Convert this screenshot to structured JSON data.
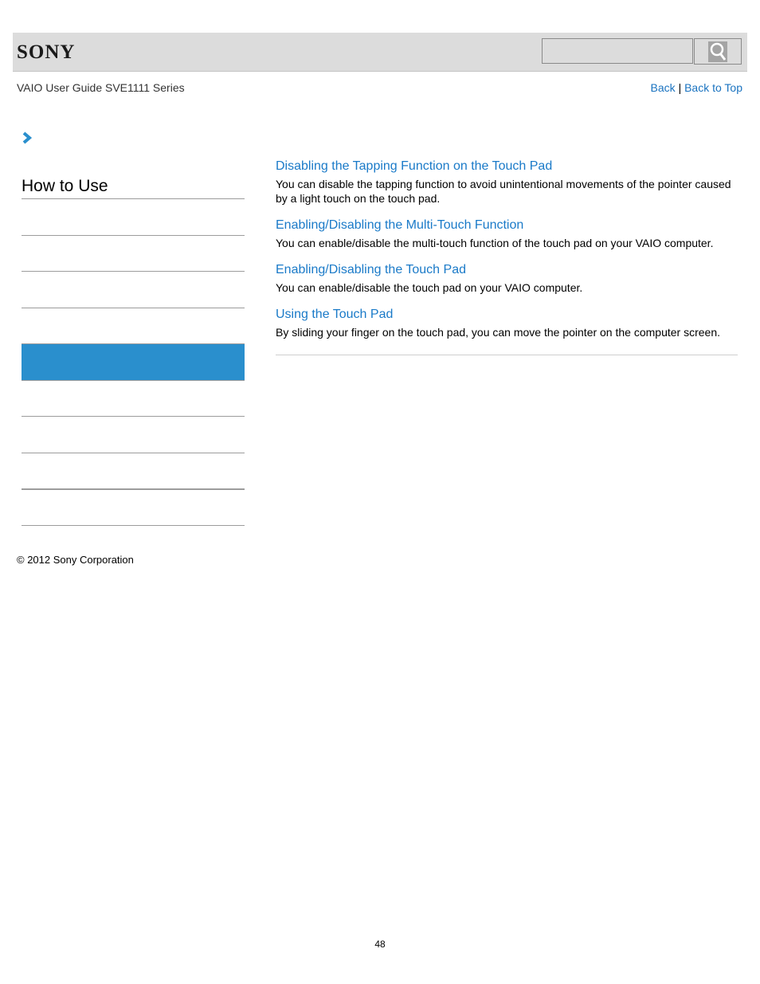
{
  "header": {
    "logo": "SONY",
    "search": {
      "placeholder": "",
      "value": "",
      "button_icon": "search-icon"
    }
  },
  "guide_title": "VAIO User Guide SVE1111 Series",
  "nav": {
    "back": "Back",
    "separator": "|",
    "back_to_top": "Back to Top"
  },
  "breadcrumb": {
    "icon": "chevron-right-icon"
  },
  "sidebar": {
    "title": "How to Use",
    "items": [
      {
        "label": "",
        "active": false
      },
      {
        "label": "",
        "active": false
      },
      {
        "label": "",
        "active": false
      },
      {
        "label": "",
        "active": false
      },
      {
        "label": "",
        "active": true
      },
      {
        "label": "",
        "active": false
      },
      {
        "label": "",
        "active": false
      },
      {
        "label": "",
        "active": false
      },
      {
        "label": "",
        "active": false
      }
    ],
    "active_color": "#2a8fcd"
  },
  "topics": [
    {
      "title": "Disabling the Tapping Function on the Touch Pad",
      "description": "You can disable the tapping function to avoid unintentional movements of the pointer caused by a light touch on the touch pad."
    },
    {
      "title": "Enabling/Disabling the Multi-Touch Function",
      "description": "You can enable/disable the multi-touch function of the touch pad on your VAIO computer."
    },
    {
      "title": "Enabling/Disabling the Touch Pad",
      "description": "You can enable/disable the touch pad on your VAIO computer."
    },
    {
      "title": "Using the Touch Pad",
      "description": "By sliding your finger on the touch pad, you can move the pointer on the computer screen."
    }
  ],
  "footer": {
    "copyright": "© 2012 Sony Corporation",
    "page_number": "48"
  },
  "colors": {
    "link": "#1a7ac8",
    "header_bg": "#dcdcdc"
  }
}
